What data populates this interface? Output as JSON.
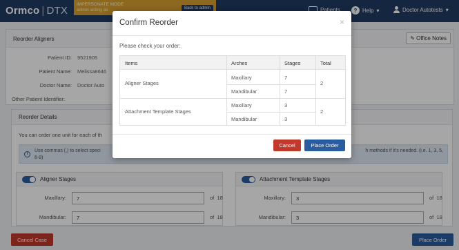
{
  "topbar": {
    "logo": "Ormco",
    "logo_sep": "|",
    "logo_product": "DTX",
    "impersonate_title": "IMPERSONATE MODE",
    "impersonate_sub": "admin acting as",
    "back_label": "Back to admin",
    "patients_label": "Patients",
    "help_label": "Help",
    "help_caret": "▾",
    "user_label": "Doctor Autotests",
    "user_caret": "▾"
  },
  "page": {
    "title": "Reorder Aligners",
    "office_notes": "Office Notes",
    "patient_id_label": "Patient ID:",
    "patient_id": "9521905",
    "patient_name_label": "Patient Name:",
    "patient_name": "Melissa8646",
    "doctor_name_label": "Doctor Name:",
    "doctor_name": "Doctor Auto",
    "other_id_label": "Other Patient Identifier:"
  },
  "details": {
    "title": "Reorder Details",
    "intro": "You can order one unit for each of th",
    "info_text": "Use commas (,) to select speci",
    "info_text2": "6-8)",
    "info_right": "h methods if it's needed. (i.e. 1, 3, 5,",
    "aligner_title": "Aligner Stages",
    "attachment_title": "Attachment Template Stages",
    "maxillary_label": "Maxillary:",
    "mandibular_label": "Mandibular:",
    "aligner_max": "7",
    "aligner_mand": "7",
    "attach_max": "3",
    "attach_mand": "3",
    "of_label": "of",
    "total_stages": "18"
  },
  "footer": {
    "cancel_case": "Cancel Case",
    "place_order": "Place Order"
  },
  "modal": {
    "title": "Confirm Reorder",
    "close": "×",
    "subtitle": "Please check your order:",
    "headers": [
      "Items",
      "Arches",
      "Stages",
      "Total"
    ],
    "rows": [
      {
        "item": "Aligner Stages",
        "max_label": "Maxillary",
        "max_stage": "7",
        "mand_label": "Mandibular",
        "mand_stage": "7",
        "total": "2"
      },
      {
        "item": "Attachment Template Stages",
        "max_label": "Maxillary",
        "max_stage": "3",
        "mand_label": "Mandibular",
        "mand_stage": "3",
        "total": "2"
      }
    ],
    "cancel": "Cancel",
    "place_order": "Place Order"
  },
  "colors": {
    "nav_bg": "#1f3b63",
    "impersonate": "#d9a030",
    "primary": "#2a5d9f",
    "danger": "#c0392b"
  }
}
